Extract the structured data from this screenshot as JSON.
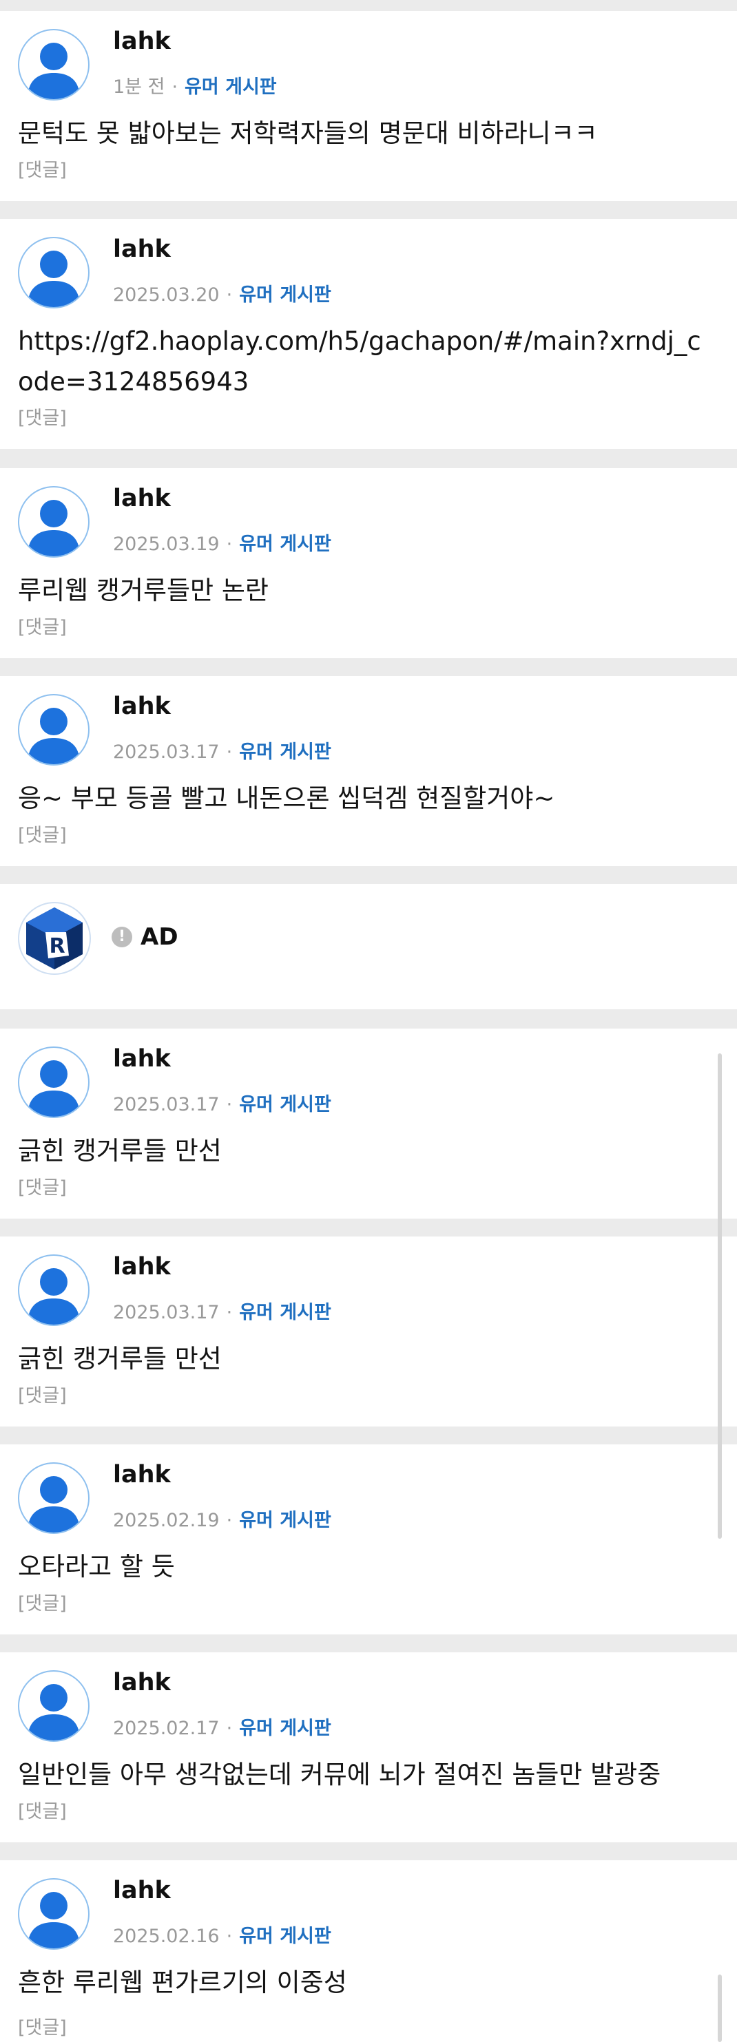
{
  "posts": [
    {
      "author": "lahk",
      "date": "1분 전",
      "board": "유머 게시판",
      "text": "문턱도 못 밟아보는 저학력자들의 명문대 비하라니ㅋㅋ",
      "reply": "[댓글]"
    },
    {
      "author": "lahk",
      "date": "2025.03.20",
      "board": "유머 게시판",
      "text": "https://gf2.haoplay.com/h5/gachapon/#/main?xrndj_code=3124856943",
      "reply": "[댓글]"
    },
    {
      "author": "lahk",
      "date": "2025.03.19",
      "board": "유머 게시판",
      "text": "루리웹 캥거루들만 논란",
      "reply": "[댓글]"
    },
    {
      "author": "lahk",
      "date": "2025.03.17",
      "board": "유머 게시판",
      "text": "응~ 부모 등골 빨고 내돈으론 씹덕겜 현질할거야~",
      "reply": "[댓글]"
    },
    {
      "author": "lahk",
      "date": "2025.03.17",
      "board": "유머 게시판",
      "text": "긁힌 캥거루들 만선",
      "reply": "[댓글]"
    },
    {
      "author": "lahk",
      "date": "2025.03.17",
      "board": "유머 게시판",
      "text": "긁힌 캥거루들 만선",
      "reply": "[댓글]"
    },
    {
      "author": "lahk",
      "date": "2025.02.19",
      "board": "유머 게시판",
      "text": "오타라고 할 듯",
      "reply": "[댓글]"
    },
    {
      "author": "lahk",
      "date": "2025.02.17",
      "board": "유머 게시판",
      "text": "일반인들 아무 생각없는데 커뮤에 뇌가 절여진 놈들만 발광중",
      "reply": "[댓글]"
    },
    {
      "author": "lahk",
      "date": "2025.02.16",
      "board": "유머 게시판",
      "text": "흔한 루리웹 편가르기의 이중성",
      "reply": "[댓글]"
    }
  ],
  "ad": {
    "label": "AD",
    "info_icon": "!",
    "logo_letter": "R"
  },
  "separator": "·",
  "colors": {
    "board_link": "#1f6fc0",
    "avatar_fill": "#1d72dd",
    "avatar_ring": "#8ec0ef",
    "divider": "#ebebeb"
  }
}
